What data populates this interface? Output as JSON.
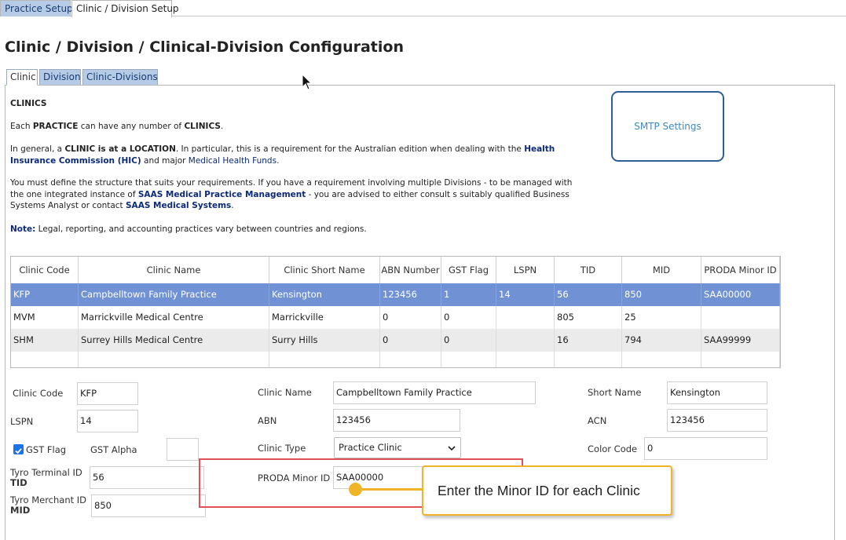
{
  "top_tabs": [
    {
      "label": "Practice Setup",
      "active": false
    },
    {
      "label": "Clinic / Division Setup",
      "active": true
    }
  ],
  "page_title": "Clinic / Division / Clinical-Division Configuration",
  "sub_tabs": [
    {
      "label": "Clinic",
      "active": true
    },
    {
      "label": "Division",
      "active": false
    },
    {
      "label": "Clinic-Divisions",
      "active": false
    }
  ],
  "info": {
    "heading": "CLINICS",
    "p1": {
      "t1": "Each ",
      "b1": "PRACTICE",
      "t2": " can have any number of ",
      "b2": "CLINICS",
      "t3": "."
    },
    "p2": {
      "t1": "In general, a ",
      "b1": "CLINIC is at a LOCATION",
      "t2": ". In particular, this is a requirement for the Australian edition when dealing with the ",
      "n1": "Health",
      "n2": "Insurance Commission (HIC)",
      "t3": " and major ",
      "m1": "Medical Health Funds",
      "t4": "."
    },
    "p3": {
      "l1": "You must define the structure that suits your requirements. If you have a requirement involving multiple Divisions - to be managed with",
      "l2a": "the one integrated instance of ",
      "l2b": "SAAS Medical Practice Management",
      "l2c": " - you are advised to either consult s suitably qualified Business",
      "l3a": "Systems Analyst or contact ",
      "l3b": "SAAS Medical Systems",
      "l3c": "."
    },
    "note": {
      "label": "Note:",
      "text": " Legal, reporting, and accounting practices vary between countries and regions."
    }
  },
  "smtp_button": "SMTP Settings",
  "grid": {
    "columns": [
      "Clinic Code",
      "Clinic Name",
      "Clinic Short Name",
      "ABN Number",
      "GST Flag",
      "LSPN",
      "TID",
      "MID",
      "PRODA Minor ID"
    ],
    "rows": [
      [
        "KFP",
        "Campbelltown Family Practice",
        "Kensington",
        "123456",
        "1",
        "14",
        "56",
        "850",
        "SAA00000"
      ],
      [
        "MVM",
        "Marrickville Medical Centre",
        "Marrickville",
        "0",
        "0",
        "",
        "805",
        "25",
        ""
      ],
      [
        "SHM",
        "Surrey Hills Medical Centre",
        "Surry Hills",
        "0",
        "0",
        "",
        "16",
        "794",
        "SAA99999"
      ]
    ]
  },
  "form": {
    "clinic_code": {
      "label": "Clinic Code",
      "value": "KFP"
    },
    "clinic_name": {
      "label": "Clinic Name",
      "value": "Campbelltown Family Practice"
    },
    "short_name": {
      "label": "Short Name",
      "value": "Kensington"
    },
    "lspn": {
      "label": "LSPN",
      "value": "14"
    },
    "abn": {
      "label": "ABN",
      "value": "123456"
    },
    "acn": {
      "label": "ACN",
      "value": "123456"
    },
    "gst_flag": {
      "label": "GST Flag",
      "checked": true
    },
    "gst_alpha": {
      "label": "GST Alpha",
      "value": ""
    },
    "clinic_type": {
      "label": "Clinic Type",
      "value": "Practice Clinic"
    },
    "color_code": {
      "label": "Color Code",
      "value": "0"
    },
    "tyro_terminal": {
      "label1": "Tyro Terminal ID",
      "label2": "TID",
      "value": "56"
    },
    "proda_minor": {
      "label": "PRODA Minor ID",
      "value": "SAA00000"
    },
    "tyro_merchant": {
      "label1": "Tyro Merchant ID",
      "label2": "MID",
      "value": "850"
    }
  },
  "callout": "Enter the Minor ID for each Clinic",
  "colors": {
    "tab_inactive": "#b6cbe6",
    "selected_row": "#7092d4",
    "callout_border": "#f0b429",
    "highlight_border": "#e05055",
    "smtp_border": "#2f5d99"
  }
}
